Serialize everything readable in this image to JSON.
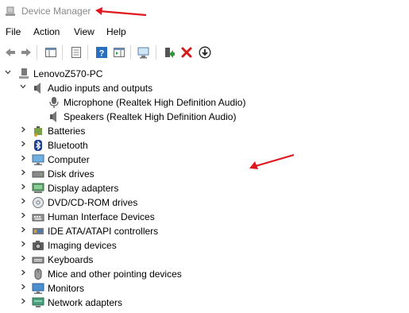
{
  "window": {
    "title": "Device Manager"
  },
  "menu": [
    "File",
    "Action",
    "View",
    "Help"
  ],
  "toolbar": {
    "buttons": [
      "back-icon",
      "forward-icon",
      "properties-pane-icon",
      "show-hidden-icon",
      "help-icon",
      "action-pane-icon",
      "scan-hardware-icon",
      "update-driver-icon",
      "uninstall-icon",
      "disable-device-icon"
    ]
  },
  "tree": {
    "computer": "LenovoZ570-PC",
    "audio": {
      "label": "Audio inputs and outputs",
      "children": [
        "Microphone (Realtek High Definition Audio)",
        "Speakers (Realtek High Definition Audio)"
      ]
    },
    "categories": [
      {
        "label": "Batteries",
        "icon": "battery-icon"
      },
      {
        "label": "Bluetooth",
        "icon": "bluetooth-icon"
      },
      {
        "label": "Computer",
        "icon": "computer-icon"
      },
      {
        "label": "Disk drives",
        "icon": "disk-drive-icon"
      },
      {
        "label": "Display adapters",
        "icon": "display-adapter-icon"
      },
      {
        "label": "DVD/CD-ROM drives",
        "icon": "dvd-drive-icon"
      },
      {
        "label": "Human Interface Devices",
        "icon": "hid-icon"
      },
      {
        "label": "IDE ATA/ATAPI controllers",
        "icon": "ide-controller-icon"
      },
      {
        "label": "Imaging devices",
        "icon": "camera-icon"
      },
      {
        "label": "Keyboards",
        "icon": "keyboard-icon"
      },
      {
        "label": "Mice and other pointing devices",
        "icon": "mouse-icon"
      },
      {
        "label": "Monitors",
        "icon": "monitor-icon"
      },
      {
        "label": "Network adapters",
        "icon": "network-adapter-icon"
      }
    ]
  },
  "colors": {
    "annotation_arrow": "#e0151d",
    "accent_blue": "#2a6ebf",
    "delete_red": "#d11a1a",
    "scan_green": "#2e9b3a"
  }
}
